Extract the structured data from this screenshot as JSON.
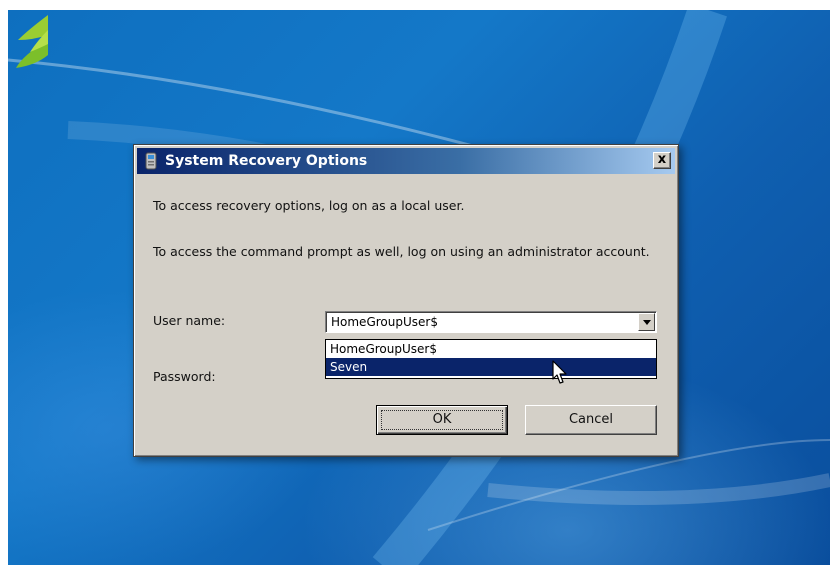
{
  "dialog": {
    "title": "System Recovery Options",
    "close_symbol": "x",
    "message_1": "To access recovery options, log on as a local user.",
    "message_2": "To access the command prompt as well, log on using an administrator account.",
    "username_label": "User name:",
    "password_label": "Password:",
    "username_value": "HomeGroupUser$",
    "dropdown_options": [
      "HomeGroupUser$",
      "Seven"
    ],
    "selected_option": "Seven",
    "ok_label": "OK",
    "cancel_label": "Cancel"
  },
  "icons": {
    "title_icon": "recovery-app-icon",
    "close_icon": "close-icon",
    "dropdown_icon": "chevron-down-icon",
    "cursor_icon": "mouse-pointer-icon"
  },
  "colors": {
    "desktop_blue": "#1478c8",
    "titlebar_dark": "#0a246a",
    "selection": "#0a246a",
    "dialog_face": "#d4d0c8"
  }
}
